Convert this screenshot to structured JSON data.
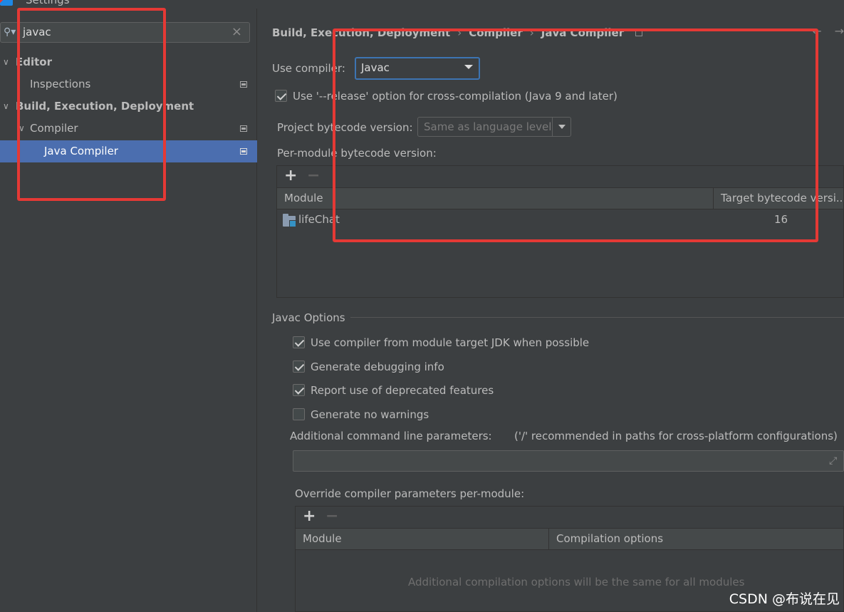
{
  "window": {
    "title": "Settings"
  },
  "search": {
    "value": "javac"
  },
  "tree": [
    {
      "label": "Editor",
      "bold": true,
      "expanded": true
    },
    {
      "label": "Inspections",
      "bold": false
    },
    {
      "label": "Build, Execution, Deployment",
      "bold": true,
      "expanded": true
    },
    {
      "label": "Compiler",
      "bold": false,
      "expanded": true
    },
    {
      "label": "Java Compiler",
      "bold": false,
      "selected": true
    }
  ],
  "breadcrumb": {
    "items": [
      "Build, Execution, Deployment",
      "Compiler",
      "Java Compiler"
    ],
    "separator": "›"
  },
  "compiler": {
    "use_compiler_label": "Use compiler:",
    "use_compiler_value": "Javac",
    "release_option_label": "Use '--release' option for cross-compilation (Java 9 and later)",
    "release_option_checked": true,
    "project_bytecode_label": "Project bytecode version:",
    "project_bytecode_value": "Same as language level",
    "per_module_label": "Per-module bytecode version:"
  },
  "module_table": {
    "columns": [
      "Module",
      "Target bytecode versi..."
    ],
    "rows": [
      {
        "module": "lifeChat",
        "target": "16"
      }
    ]
  },
  "javac_options": {
    "section_title": "Javac Options",
    "options": [
      {
        "label": "Use compiler from module target JDK when possible",
        "checked": true
      },
      {
        "label": "Generate debugging info",
        "checked": true
      },
      {
        "label": "Report use of deprecated features",
        "checked": true
      },
      {
        "label": "Generate no warnings",
        "checked": false
      }
    ],
    "additional_params_label": "Additional command line parameters:",
    "additional_params_hint": "('/' recommended in paths for cross-platform configurations)",
    "additional_params_value": "",
    "override_label": "Override compiler parameters per-module:",
    "override_columns": [
      "Module",
      "Compilation options"
    ],
    "override_empty": "Additional compilation options will be the same for all modules"
  },
  "watermark": "CSDN @布说在见",
  "colors": {
    "selection": "#4b6eaf",
    "annotation": "#e53935",
    "focus": "#3d74b2"
  }
}
